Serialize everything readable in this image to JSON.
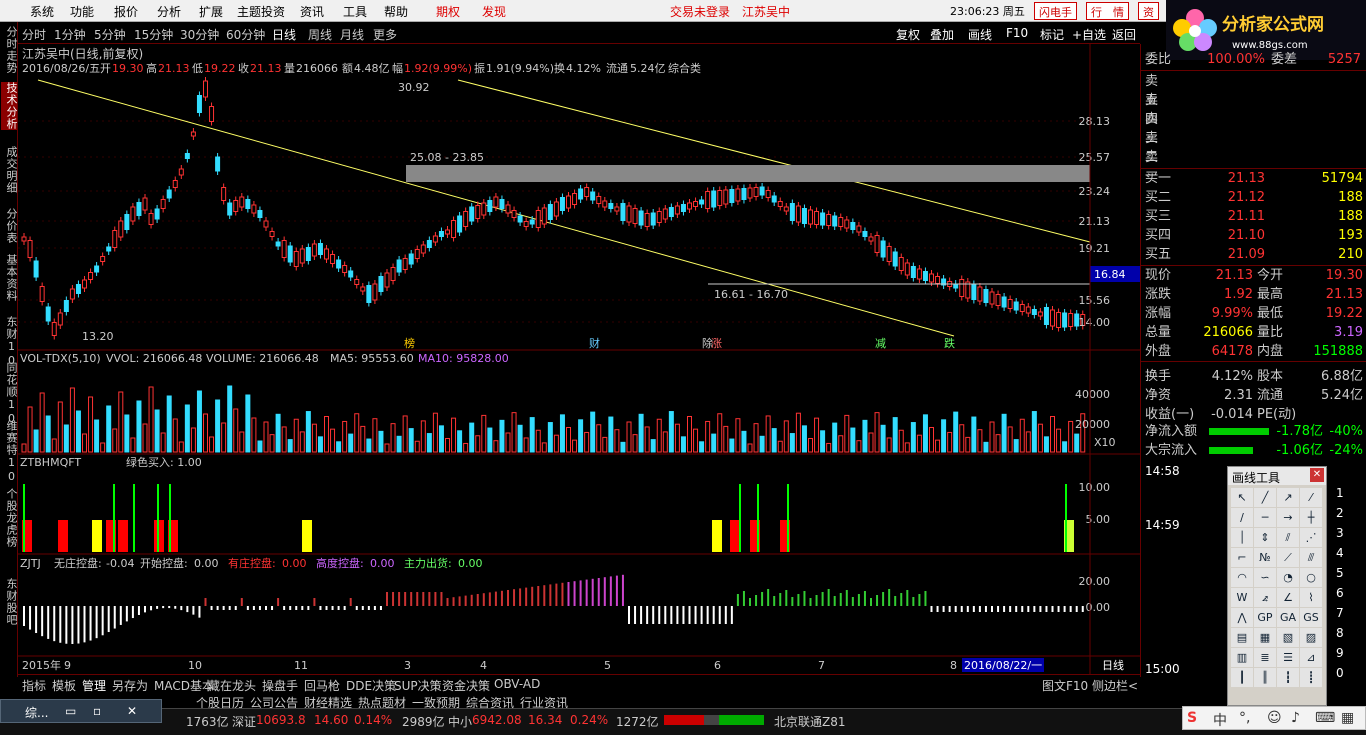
{
  "menubar": {
    "items": [
      "系统",
      "功能",
      "报价",
      "分析",
      "扩展",
      "主题投资",
      "资讯",
      "工具",
      "帮助"
    ],
    "right": [
      "期权",
      "发现"
    ],
    "login_status": "交易未登录",
    "stock_name": "江苏吴中",
    "clock": "23:06:23 周五",
    "btn1": "闪电手",
    "btn2": "行　情",
    "btn3": "资"
  },
  "logo": {
    "title": "分析家公式网",
    "url": "www.88gs.com"
  },
  "vtabs": [
    "分时走势",
    "技术分析",
    "成交明细",
    "分价表",
    "基本资料",
    "东财10",
    "同花顺10",
    "维赛特10",
    "个股龙虎榜",
    "东财股吧"
  ],
  "periods": [
    "分时",
    "1分钟",
    "5分钟",
    "15分钟",
    "30分钟",
    "60分钟",
    "日线",
    "周线",
    "月线",
    "更多"
  ],
  "right_tools": [
    "复权",
    "叠加",
    "画线",
    "F10",
    "标记",
    "+自选",
    "返回"
  ],
  "chart": {
    "title": "江苏吴中(日线,前复权)",
    "info": {
      "date": "2016/08/26/五",
      "open_label": "开",
      "open": "19.30",
      "high_label": "高",
      "high": "21.13",
      "low_label": "低",
      "low": "19.22",
      "close_label": "收",
      "close": "21.13",
      "vol_label": "量",
      "vol": "216066",
      "amt_label": "额",
      "amt": "4.48亿",
      "chg_label": "幅",
      "chg": "1.92(9.99%)",
      "amp_label": "振",
      "amp": "1.91(9.94%)",
      "turn_label": "换",
      "turn": "4.12%",
      "flow_label": "流通",
      "flow": "5.24亿",
      "cat": "综合类"
    },
    "price_axis": [
      "28.13",
      "25.57",
      "23.24",
      "21.13",
      "19.21",
      "16.84",
      "15.56",
      "14.00"
    ],
    "annotations": {
      "high": "30.92",
      "low": "13.20",
      "zone_top": "25.08 - 23.85",
      "zone_bottom": "16.61 - 16.70"
    },
    "events": [
      "榜",
      "财",
      "除",
      "涨",
      "减",
      "跌"
    ],
    "vol": {
      "title": "VOL-TDX(5,10)",
      "vol_label": "VVOL: 216066.48",
      "volume_label": "VOLUME: 216066.48",
      "ma5": "MA5: 95553.60",
      "ma10": "MA10: 95828.00",
      "axis": [
        "40000",
        "20000"
      ],
      "unit": "X10"
    },
    "ztb": {
      "title": "ZTBHMQFT",
      "buy": "绿色买入: 1.00",
      "axis": [
        "10.00",
        "5.00"
      ],
      "labels": [
        "开警",
        "涨停"
      ]
    },
    "zjtj": {
      "title": "ZJTJ",
      "items": [
        {
          "k": "无庄控盘:",
          "v": "-0.04"
        },
        {
          "k": "开始控盘:",
          "v": "0.00"
        },
        {
          "k": "有庄控盘:",
          "v": "0.00"
        },
        {
          "k": "高度控盘:",
          "v": "0.00"
        },
        {
          "k": "主力出货:",
          "v": "0.00"
        }
      ],
      "axis": [
        "20.00",
        "0.00"
      ]
    },
    "date_axis": [
      "2015年",
      "9",
      "10",
      "11",
      "3",
      "4",
      "5",
      "6",
      "7",
      "8"
    ],
    "date_cursor": "2016/08/22/一",
    "period_label": "日线"
  },
  "orderbook": {
    "wb_label": "委比",
    "wb": "100.00%",
    "wc_label": "委差",
    "wc": "5257",
    "sells": [
      {
        "k": "卖五"
      },
      {
        "k": "卖四"
      },
      {
        "k": "卖三"
      },
      {
        "k": "卖二"
      },
      {
        "k": "卖一"
      }
    ],
    "buys": [
      {
        "k": "买一",
        "p": "21.13",
        "v": "51794"
      },
      {
        "k": "买二",
        "p": "21.12",
        "v": "188"
      },
      {
        "k": "买三",
        "p": "21.11",
        "v": "188"
      },
      {
        "k": "买四",
        "p": "21.10",
        "v": "193"
      },
      {
        "k": "买五",
        "p": "21.09",
        "v": "210"
      }
    ]
  },
  "quote": [
    {
      "k1": "现价",
      "v1": "21.13",
      "k2": "今开",
      "v2": "19.30"
    },
    {
      "k1": "涨跌",
      "v1": "1.92",
      "k2": "最高",
      "v2": "21.13"
    },
    {
      "k1": "涨幅",
      "v1": "9.99%",
      "k2": "最低",
      "v2": "19.22"
    },
    {
      "k1": "总量",
      "v1": "216066",
      "k2": "量比",
      "v2": "3.19"
    },
    {
      "k1": "外盘",
      "v1": "64178",
      "k2": "内盘",
      "v2": "151888"
    },
    {
      "k1": "换手",
      "v1": "4.12%",
      "k2": "股本",
      "v2": "6.88亿"
    },
    {
      "k1": "净资",
      "v1": "2.31",
      "k2": "流通",
      "v2": "5.24亿"
    },
    {
      "k1": "收益(一)",
      "v1": "-0.014",
      "k2": "PE(动)",
      "v2": ""
    }
  ],
  "flows": [
    {
      "k": "净流入额",
      "v": "-1.78亿",
      "p": "-40%"
    },
    {
      "k": "大宗流入",
      "v": "-1.06亿",
      "p": "-24%"
    }
  ],
  "ticks": [
    "14:58",
    "14:59",
    "15:00"
  ],
  "tools": {
    "title": "画线工具",
    "nums": [
      "1",
      "2",
      "3",
      "4",
      "5",
      "6",
      "7",
      "8",
      "9",
      "0"
    ]
  },
  "btabs": [
    "指标",
    "模板",
    "管理",
    "另存为",
    "MACD基本",
    "藏在龙头",
    "操盘手",
    "回马枪",
    "DDE决策",
    "SUP决策",
    "资金决策",
    "OBV-AD"
  ],
  "btabs_right": [
    "图文F10",
    "侧边栏<"
  ],
  "btabs2": [
    "个股日历",
    "公司公告",
    "财经精选",
    "热点题材",
    "一致预期",
    "综合资讯",
    "行业资讯"
  ],
  "status": {
    "s1": "1763亿",
    "s2_label": "深证",
    "s2": "10693.8",
    "s3": "14.60",
    "s4": "0.14%",
    "s5": "2989亿",
    "s6_label": "中小",
    "s6": "6942.08",
    "s7": "16.34",
    "s8": "0.24%",
    "s9": "1272亿",
    "s10": "北京联通Z81"
  },
  "taskbar": {
    "label": "综..."
  },
  "ime": {
    "label": "中"
  }
}
